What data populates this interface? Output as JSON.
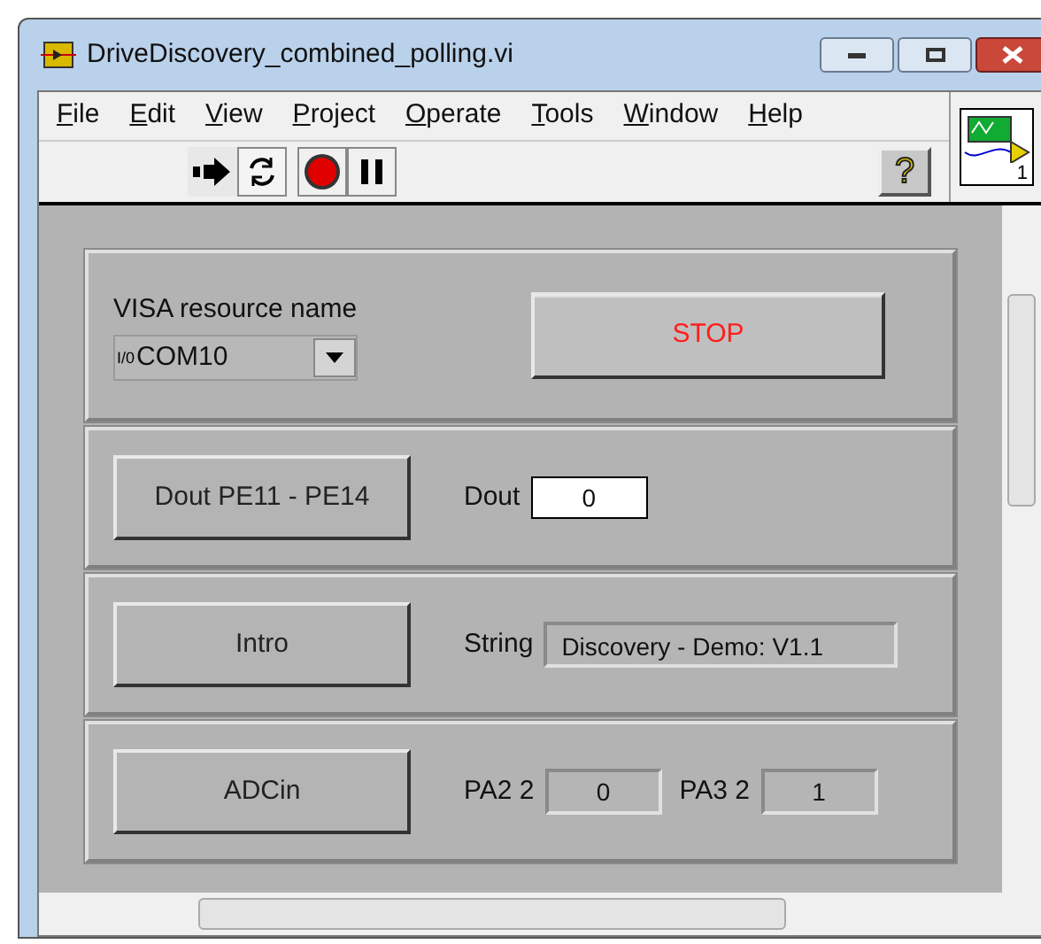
{
  "window": {
    "title": "DriveDiscovery_combined_polling.vi"
  },
  "menu": [
    "File",
    "Edit",
    "View",
    "Project",
    "Operate",
    "Tools",
    "Window",
    "Help"
  ],
  "connector_pane": {
    "label": "1"
  },
  "toolbar": {
    "help_button": "?"
  },
  "sections": [
    {
      "kind": "resource",
      "label": "VISA resource name",
      "io_prefix": "I/0",
      "value": "COM10",
      "button": "STOP"
    },
    {
      "kind": "control",
      "button": "Dout PE11 - PE14",
      "fields": [
        {
          "label": "Dout",
          "value": "0",
          "editable": true
        }
      ]
    },
    {
      "kind": "string",
      "button": "Intro",
      "fields": [
        {
          "label": "String",
          "value": "Discovery - Demo: V1.1",
          "editable": false
        }
      ]
    },
    {
      "kind": "control",
      "button": "ADCin",
      "fields": [
        {
          "label": "PA2 2",
          "value": "0",
          "editable": false
        },
        {
          "label": "PA3 2",
          "value": "1",
          "editable": false
        }
      ]
    }
  ]
}
